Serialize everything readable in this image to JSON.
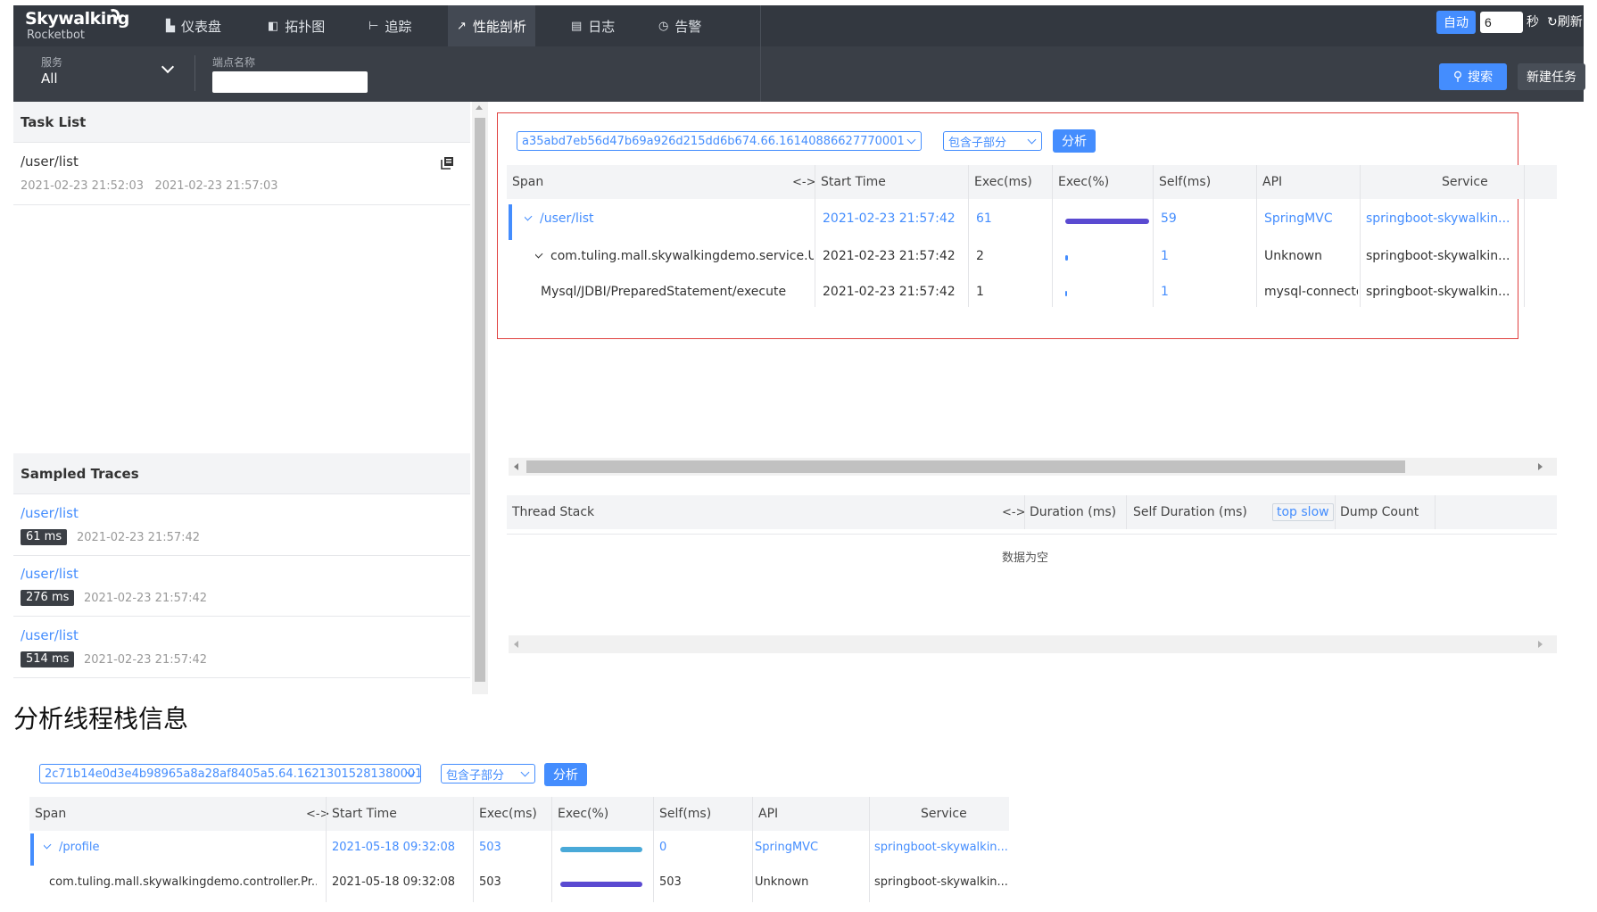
{
  "nav": {
    "logo": "Skywalking",
    "logo_sub": "Rocketbot",
    "items": [
      {
        "icon": "▙",
        "label": "仪表盘"
      },
      {
        "icon": "◧",
        "label": "拓扑图"
      },
      {
        "icon": "⊢",
        "label": "追踪"
      },
      {
        "icon": "↗",
        "label": "性能剖析"
      },
      {
        "icon": "▤",
        "label": "日志"
      },
      {
        "icon": "◷",
        "label": "告警"
      }
    ],
    "auto_label": "自动",
    "auto_value": "6",
    "sec_label": "秒",
    "refresh_label": "刷新"
  },
  "toolbar": {
    "service_label": "服务",
    "service_value": "All",
    "endpoint_label": "端点名称",
    "search_label": "搜索",
    "new_task_label": "新建任务"
  },
  "task_list": {
    "title": "Task List",
    "items": [
      {
        "name": "/user/list",
        "start": "2021-02-23 21:52:03",
        "end": "2021-02-23 21:57:03"
      }
    ]
  },
  "sampled": {
    "title": "Sampled Traces",
    "items": [
      {
        "name": "/user/list",
        "duration": "61 ms",
        "time": "2021-02-23 21:57:42"
      },
      {
        "name": "/user/list",
        "duration": "276 ms",
        "time": "2021-02-23 21:57:42"
      },
      {
        "name": "/user/list",
        "duration": "514 ms",
        "time": "2021-02-23 21:57:42"
      }
    ]
  },
  "analysis1": {
    "segment": "a35abd7eb56d47b69a926d215dd6b674.66.16140886627770001",
    "mode": "包含子部分",
    "analyze_label": "分析",
    "headers": [
      "Span",
      "<->",
      "Start Time",
      "Exec(ms)",
      "Exec(%)",
      "Self(ms)",
      "API",
      "Service"
    ],
    "rows": [
      {
        "span": "/user/list",
        "start": "2021-02-23 21:57:42",
        "exec": "61",
        "pct": 1.0,
        "self": "59",
        "api": "SpringMVC",
        "service": "springboot-skywalkin..."
      },
      {
        "span": "com.tuling.mall.skywalkingdemo.service.U...",
        "start": "2021-02-23 21:57:42",
        "exec": "2",
        "pct": 0.03,
        "self": "1",
        "api": "Unknown",
        "service": "springboot-skywalkin..."
      },
      {
        "span": "Mysql/JDBI/PreparedStatement/execute",
        "start": "2021-02-23 21:57:42",
        "exec": "1",
        "pct": 0.02,
        "self": "1",
        "api": "mysql-connector...",
        "service": "springboot-skywalkin..."
      }
    ]
  },
  "thread_stack": {
    "headers": [
      "Thread Stack",
      "<->",
      "Duration (ms)",
      "Self Duration (ms)",
      "top slow",
      "Dump Count"
    ],
    "empty": "数据为空"
  },
  "heading": "分析线程栈信息",
  "analysis2": {
    "segment": "2c71b14e0d3e4b98965a8a28af8405a5.64.16213015281380001",
    "mode": "包含子部分",
    "analyze_label": "分析",
    "headers": [
      "Span",
      "<->",
      "Start Time",
      "Exec(ms)",
      "Exec(%)",
      "Self(ms)",
      "API",
      "Service"
    ],
    "rows": [
      {
        "span": "/profile",
        "start": "2021-05-18 09:32:08",
        "exec": "503",
        "pct": 1.0,
        "self": "0",
        "api": "SpringMVC",
        "service": "springboot-skywalkin..."
      },
      {
        "span": "com.tuling.mall.skywalkingdemo.controller.Pr...",
        "start": "2021-05-18 09:32:08",
        "exec": "503",
        "pct": 1.0,
        "self": "503",
        "api": "Unknown",
        "service": "springboot-skywalkin..."
      }
    ]
  },
  "colors": {
    "accent": "#448dfe",
    "bar1": "#5a4ad1",
    "bar2": "#49a9d8",
    "red_box": "#e0413f"
  }
}
